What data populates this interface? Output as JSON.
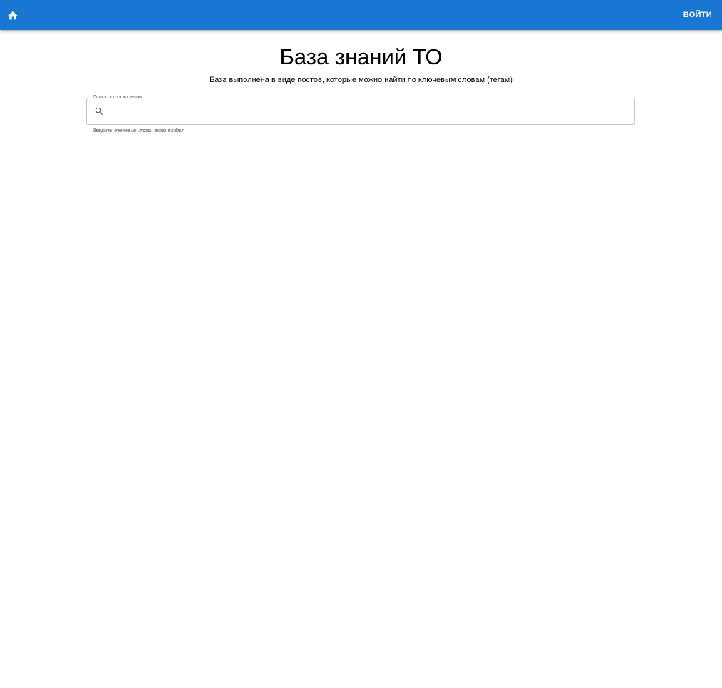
{
  "appbar": {
    "home_icon": "home-icon",
    "login_label": "ВОЙТИ",
    "background_color": "#1976d2"
  },
  "main": {
    "title": "База знаний ТО",
    "subtitle": "База выполнена в виде постов, которые можно найти по ключевым словам (тегам)"
  },
  "search": {
    "label": "Поиск поста по тегам",
    "value": "",
    "icon": "search-icon",
    "helper": "Введите ключевые слова через пробел"
  }
}
